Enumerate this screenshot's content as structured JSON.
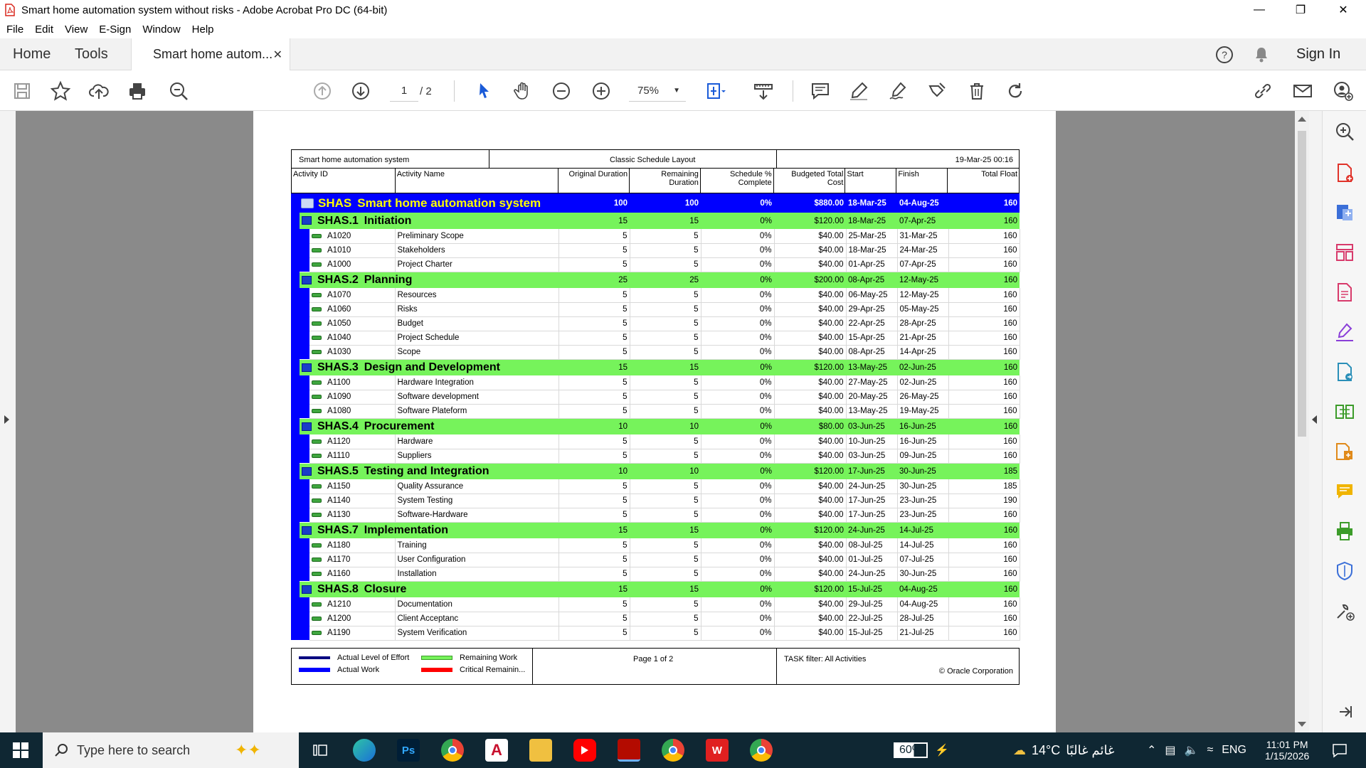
{
  "window": {
    "title": "Smart home automation system without risks - Adobe Acrobat Pro DC (64-bit)"
  },
  "menu": [
    "File",
    "Edit",
    "View",
    "E-Sign",
    "Window",
    "Help"
  ],
  "tabs": {
    "home": "Home",
    "tools": "Tools",
    "doc": "Smart home autom...",
    "sign_in": "Sign In"
  },
  "toolbar": {
    "page_current": "1",
    "page_total": "/ 2",
    "zoom": "75%"
  },
  "report": {
    "project_name": "Smart home automation system",
    "layout": "Classic Schedule Layout",
    "date": "19-Mar-25 00:16",
    "columns": [
      "Activity ID",
      "Activity Name",
      "Original Duration",
      "Remaining Duration",
      "Schedule % Complete",
      "Budgeted Total Cost",
      "Start",
      "Finish",
      "Total Float"
    ],
    "rows": [
      {
        "type": "proj",
        "id": "SHAS",
        "name": "Smart home automation system",
        "od": "100",
        "rd": "100",
        "pc": "0%",
        "cost": "$880.00",
        "start": "18-Mar-25",
        "finish": "04-Aug-25",
        "tf": "160"
      },
      {
        "type": "wbs",
        "id": "SHAS.1",
        "name": "Initiation",
        "od": "15",
        "rd": "15",
        "pc": "0%",
        "cost": "$120.00",
        "start": "18-Mar-25",
        "finish": "07-Apr-25",
        "tf": "160"
      },
      {
        "type": "act",
        "id": "A1020",
        "name": "Preliminary Scope",
        "od": "5",
        "rd": "5",
        "pc": "0%",
        "cost": "$40.00",
        "start": "25-Mar-25",
        "finish": "31-Mar-25",
        "tf": "160"
      },
      {
        "type": "act",
        "id": "A1010",
        "name": "Stakeholders",
        "od": "5",
        "rd": "5",
        "pc": "0%",
        "cost": "$40.00",
        "start": "18-Mar-25",
        "finish": "24-Mar-25",
        "tf": "160"
      },
      {
        "type": "act",
        "id": "A1000",
        "name": "Project Charter",
        "od": "5",
        "rd": "5",
        "pc": "0%",
        "cost": "$40.00",
        "start": "01-Apr-25",
        "finish": "07-Apr-25",
        "tf": "160"
      },
      {
        "type": "wbs",
        "id": "SHAS.2",
        "name": "Planning",
        "od": "25",
        "rd": "25",
        "pc": "0%",
        "cost": "$200.00",
        "start": "08-Apr-25",
        "finish": "12-May-25",
        "tf": "160"
      },
      {
        "type": "act",
        "id": "A1070",
        "name": "Resources",
        "od": "5",
        "rd": "5",
        "pc": "0%",
        "cost": "$40.00",
        "start": "06-May-25",
        "finish": "12-May-25",
        "tf": "160"
      },
      {
        "type": "act",
        "id": "A1060",
        "name": "Risks",
        "od": "5",
        "rd": "5",
        "pc": "0%",
        "cost": "$40.00",
        "start": "29-Apr-25",
        "finish": "05-May-25",
        "tf": "160"
      },
      {
        "type": "act",
        "id": "A1050",
        "name": "Budget",
        "od": "5",
        "rd": "5",
        "pc": "0%",
        "cost": "$40.00",
        "start": "22-Apr-25",
        "finish": "28-Apr-25",
        "tf": "160"
      },
      {
        "type": "act",
        "id": "A1040",
        "name": "Project Schedule",
        "od": "5",
        "rd": "5",
        "pc": "0%",
        "cost": "$40.00",
        "start": "15-Apr-25",
        "finish": "21-Apr-25",
        "tf": "160"
      },
      {
        "type": "act",
        "id": "A1030",
        "name": "Scope",
        "od": "5",
        "rd": "5",
        "pc": "0%",
        "cost": "$40.00",
        "start": "08-Apr-25",
        "finish": "14-Apr-25",
        "tf": "160"
      },
      {
        "type": "wbs",
        "id": "SHAS.3",
        "name": "Design and Development",
        "od": "15",
        "rd": "15",
        "pc": "0%",
        "cost": "$120.00",
        "start": "13-May-25",
        "finish": "02-Jun-25",
        "tf": "160"
      },
      {
        "type": "act",
        "id": "A1100",
        "name": "Hardware Integration",
        "od": "5",
        "rd": "5",
        "pc": "0%",
        "cost": "$40.00",
        "start": "27-May-25",
        "finish": "02-Jun-25",
        "tf": "160"
      },
      {
        "type": "act",
        "id": "A1090",
        "name": "Software development",
        "od": "5",
        "rd": "5",
        "pc": "0%",
        "cost": "$40.00",
        "start": "20-May-25",
        "finish": "26-May-25",
        "tf": "160"
      },
      {
        "type": "act",
        "id": "A1080",
        "name": "Software Plateform",
        "od": "5",
        "rd": "5",
        "pc": "0%",
        "cost": "$40.00",
        "start": "13-May-25",
        "finish": "19-May-25",
        "tf": "160"
      },
      {
        "type": "wbs",
        "id": "SHAS.4",
        "name": "Procurement",
        "od": "10",
        "rd": "10",
        "pc": "0%",
        "cost": "$80.00",
        "start": "03-Jun-25",
        "finish": "16-Jun-25",
        "tf": "160"
      },
      {
        "type": "act",
        "id": "A1120",
        "name": "Hardware",
        "od": "5",
        "rd": "5",
        "pc": "0%",
        "cost": "$40.00",
        "start": "10-Jun-25",
        "finish": "16-Jun-25",
        "tf": "160"
      },
      {
        "type": "act",
        "id": "A1110",
        "name": "Suppliers",
        "od": "5",
        "rd": "5",
        "pc": "0%",
        "cost": "$40.00",
        "start": "03-Jun-25",
        "finish": "09-Jun-25",
        "tf": "160"
      },
      {
        "type": "wbs",
        "id": "SHAS.5",
        "name": "Testing and Integration",
        "od": "10",
        "rd": "10",
        "pc": "0%",
        "cost": "$120.00",
        "start": "17-Jun-25",
        "finish": "30-Jun-25",
        "tf": "185"
      },
      {
        "type": "act",
        "id": "A1150",
        "name": "Quality Assurance",
        "od": "5",
        "rd": "5",
        "pc": "0%",
        "cost": "$40.00",
        "start": "24-Jun-25",
        "finish": "30-Jun-25",
        "tf": "185"
      },
      {
        "type": "act",
        "id": "A1140",
        "name": "System Testing",
        "od": "5",
        "rd": "5",
        "pc": "0%",
        "cost": "$40.00",
        "start": "17-Jun-25",
        "finish": "23-Jun-25",
        "tf": "190"
      },
      {
        "type": "act",
        "id": "A1130",
        "name": "Software-Hardware",
        "od": "5",
        "rd": "5",
        "pc": "0%",
        "cost": "$40.00",
        "start": "17-Jun-25",
        "finish": "23-Jun-25",
        "tf": "160"
      },
      {
        "type": "wbs",
        "id": "SHAS.7",
        "name": "Implementation",
        "od": "15",
        "rd": "15",
        "pc": "0%",
        "cost": "$120.00",
        "start": "24-Jun-25",
        "finish": "14-Jul-25",
        "tf": "160"
      },
      {
        "type": "act",
        "id": "A1180",
        "name": "Training",
        "od": "5",
        "rd": "5",
        "pc": "0%",
        "cost": "$40.00",
        "start": "08-Jul-25",
        "finish": "14-Jul-25",
        "tf": "160"
      },
      {
        "type": "act",
        "id": "A1170",
        "name": "User Configuration",
        "od": "5",
        "rd": "5",
        "pc": "0%",
        "cost": "$40.00",
        "start": "01-Jul-25",
        "finish": "07-Jul-25",
        "tf": "160"
      },
      {
        "type": "act",
        "id": "A1160",
        "name": "Installation",
        "od": "5",
        "rd": "5",
        "pc": "0%",
        "cost": "$40.00",
        "start": "24-Jun-25",
        "finish": "30-Jun-25",
        "tf": "160"
      },
      {
        "type": "wbs",
        "id": "SHAS.8",
        "name": "Closure",
        "od": "15",
        "rd": "15",
        "pc": "0%",
        "cost": "$120.00",
        "start": "15-Jul-25",
        "finish": "04-Aug-25",
        "tf": "160"
      },
      {
        "type": "act",
        "id": "A1210",
        "name": "Documentation",
        "od": "5",
        "rd": "5",
        "pc": "0%",
        "cost": "$40.00",
        "start": "29-Jul-25",
        "finish": "04-Aug-25",
        "tf": "160"
      },
      {
        "type": "act",
        "id": "A1200",
        "name": "Client Acceptanc",
        "od": "5",
        "rd": "5",
        "pc": "0%",
        "cost": "$40.00",
        "start": "22-Jul-25",
        "finish": "28-Jul-25",
        "tf": "160"
      },
      {
        "type": "act",
        "id": "A1190",
        "name": "System Verification",
        "od": "5",
        "rd": "5",
        "pc": "0%",
        "cost": "$40.00",
        "start": "15-Jul-25",
        "finish": "21-Jul-25",
        "tf": "160"
      }
    ],
    "legend": {
      "actual_loe": "Actual Level of Effort",
      "actual_work": "Actual Work",
      "remaining_work": "Remaining Work",
      "critical_remaining": "Critical Remainin...",
      "page": "Page 1 of 2",
      "filter": "TASK filter: All Activities",
      "copyright": "© Oracle Corporation"
    }
  },
  "taskbar": {
    "search_placeholder": "Type here to search",
    "battery": "60%",
    "temperature": "14°C",
    "weather": "غائم غالبًا",
    "lang": "ENG",
    "time": "11:01 PM",
    "date": "1/15/2026"
  },
  "colors": {
    "project_row": "#0000ff",
    "wbs_row": "#76f35b",
    "project_text": "#ffff00"
  }
}
